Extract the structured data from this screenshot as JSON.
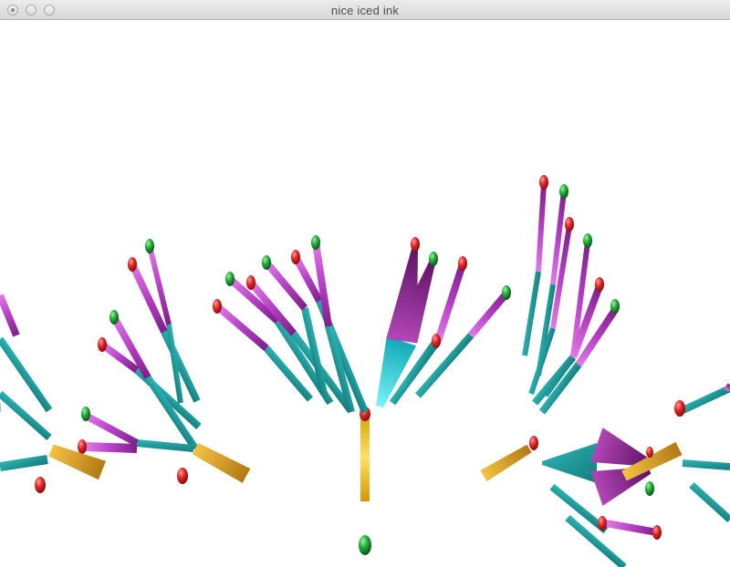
{
  "window": {
    "title": "nice iced ink"
  },
  "titlebar": {
    "buttons": [
      {
        "name": "close-button",
        "icon": "close-icon"
      },
      {
        "name": "minimize-button",
        "icon": "minimize-icon"
      },
      {
        "name": "zoom-button",
        "icon": "zoom-icon"
      }
    ]
  },
  "scene": {
    "description_colors": {
      "teal": "#1aa3a3",
      "cyan": "#2fd6e0",
      "magenta": "#c04ad0",
      "purple": "#7a1f7e",
      "gold": "#e0a42a",
      "yellow": "#ffd43b",
      "red": "#e02b2b",
      "green": "#22a83a",
      "background": "#ffffff"
    }
  }
}
